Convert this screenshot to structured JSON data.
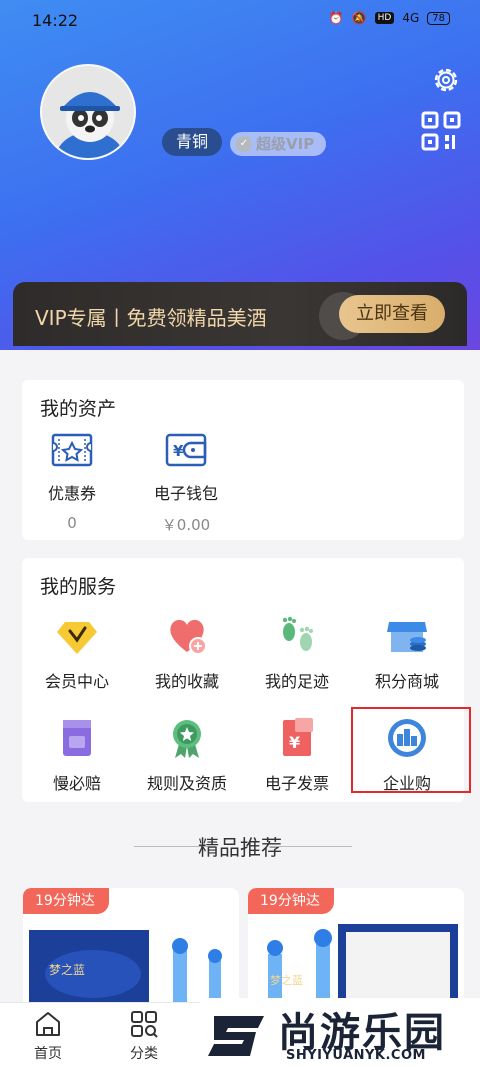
{
  "status": {
    "time": "14:22",
    "hd": "HD",
    "signal": "4G",
    "battery": "78"
  },
  "profile": {
    "level": "青铜",
    "vip": "超级VIP"
  },
  "vip_banner": {
    "text": "VIP专属丨免费领精品美酒",
    "button": "立即查看"
  },
  "assets": {
    "title": "我的资产",
    "items": [
      {
        "label": "优惠券",
        "value": "0",
        "icon": "coupon-icon"
      },
      {
        "label": "电子钱包",
        "value": "￥0.00",
        "icon": "wallet-icon"
      }
    ]
  },
  "services": {
    "title": "我的服务",
    "items": [
      {
        "label": "会员中心",
        "icon": "member-diamond-icon"
      },
      {
        "label": "我的收藏",
        "icon": "favorite-heart-icon"
      },
      {
        "label": "我的足迹",
        "icon": "footprint-icon"
      },
      {
        "label": "积分商城",
        "icon": "points-store-icon"
      },
      {
        "label": "慢必赔",
        "icon": "compensation-icon"
      },
      {
        "label": "规则及资质",
        "icon": "rules-badge-icon"
      },
      {
        "label": "电子发票",
        "icon": "invoice-icon"
      },
      {
        "label": "企业购",
        "icon": "enterprise-icon"
      }
    ]
  },
  "recommend": {
    "title": "精品推荐",
    "products": [
      {
        "tag": "19分钟达"
      },
      {
        "tag": "19分钟达"
      }
    ]
  },
  "tabbar": {
    "items": [
      {
        "label": "首页"
      },
      {
        "label": "分类"
      }
    ]
  },
  "watermark": {
    "main": "尚游乐园",
    "sub": "SHYIYUANYK.COM"
  }
}
